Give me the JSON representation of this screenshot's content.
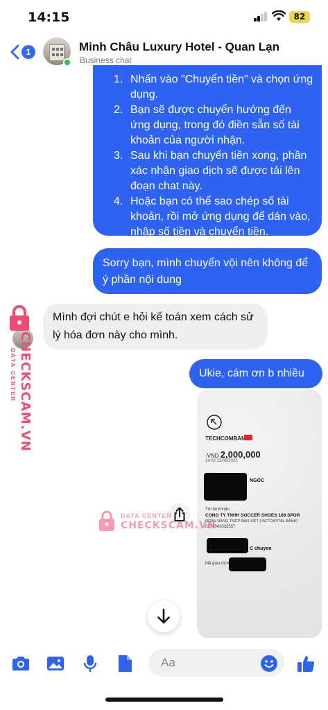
{
  "status_bar": {
    "time": "14:15",
    "battery": "82"
  },
  "header": {
    "back_count": "1",
    "title": "Minh Châu Luxury Hotel - Quan Lạn",
    "subtitle": "Business chat"
  },
  "messages": {
    "instructions": [
      {
        "num": "1.",
        "text": "Nhấn vào \"Chuyển tiền\" và chọn ứng dụng."
      },
      {
        "num": "2.",
        "text": "Bạn sẽ được chuyển hướng đến ứng dụng, trong đó điền sẵn số tài khoản của người nhận."
      },
      {
        "num": "3.",
        "text": "Sau khi bạn chuyển tiền xong, phần xác nhận giao dịch sẽ được tải lên đoạn chat này."
      },
      {
        "num": "4.",
        "text": "Hoặc bạn có thể sao chép số tài khoản, rồi mở ứng dụng để dán vào, nhập số tiền và chuyển tiền."
      }
    ],
    "sorry": "Sorry bạn, mình chuyển vội nên không để ý phần nội dung",
    "reply": "Mình đợi chút e hỏi kế toán xem cách sử lý hóa đơn này cho mình.",
    "thanks": "Ukie, cám ơn b nhiều"
  },
  "receipt": {
    "bank": "TECHCOMBANK",
    "currency": "-VND",
    "amount": "2,000,000",
    "datetime": "14:02 23/06/2020",
    "name_suffix": "NGOC",
    "to_label": "Tới tài khoản",
    "to_name": "CONG TY TNHH SOCCER SHOES 168 SPOR",
    "to_bank": "NGAN HANG TMCP BAN VIET (VIETCAPITAL BANK)",
    "to_account": "0277041032557",
    "memo": "C chuyen",
    "txn_label": "Mã giao dịch: FT"
  },
  "watermark": {
    "side_big": "CHECKSCAM.VN",
    "side_small": "DATA CENTER",
    "center_small": "DATA CENTER",
    "center_big": "CHECKSCAM.VN",
    "color": "#ee4d72"
  },
  "composer": {
    "placeholder": "Aa"
  },
  "colors": {
    "accent": "#2d63f0",
    "incoming_bubble": "#efeff1",
    "online": "#31c24d"
  },
  "icons": [
    "back-icon",
    "camera-icon",
    "photo-icon",
    "microphone-icon",
    "file-icon",
    "emoji-icon",
    "thumbs-up-icon",
    "share-icon",
    "arrow-down-icon",
    "lock-icon"
  ]
}
